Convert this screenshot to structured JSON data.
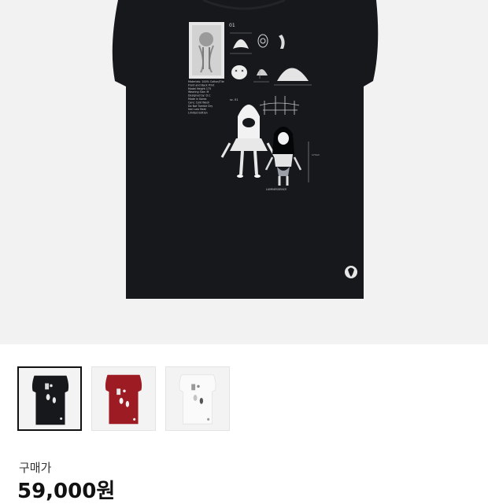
{
  "product": {
    "number_label": "01",
    "size_label": "LUMINESSENCE",
    "spec_text": [
      "Materials: 100% Cotton/Tile",
      "Front and Back Print",
      "Model Height 175",
      "Wearing Size: M",
      "Designed by: D.C",
      "Made in Korea",
      "Care: Cold Wash",
      "Do Not Tumble Dry",
      "Iron Low Heat",
      "Limited Edition"
    ],
    "colors": {
      "black": "#16181c",
      "red": "#9d1b22",
      "white": "#fafafa"
    }
  },
  "thumbnails": [
    {
      "color": "black",
      "selected": true
    },
    {
      "color": "red",
      "selected": false
    },
    {
      "color": "white",
      "selected": false
    }
  ],
  "purchase": {
    "price_label": "구매가",
    "price_value": "59,000원"
  }
}
